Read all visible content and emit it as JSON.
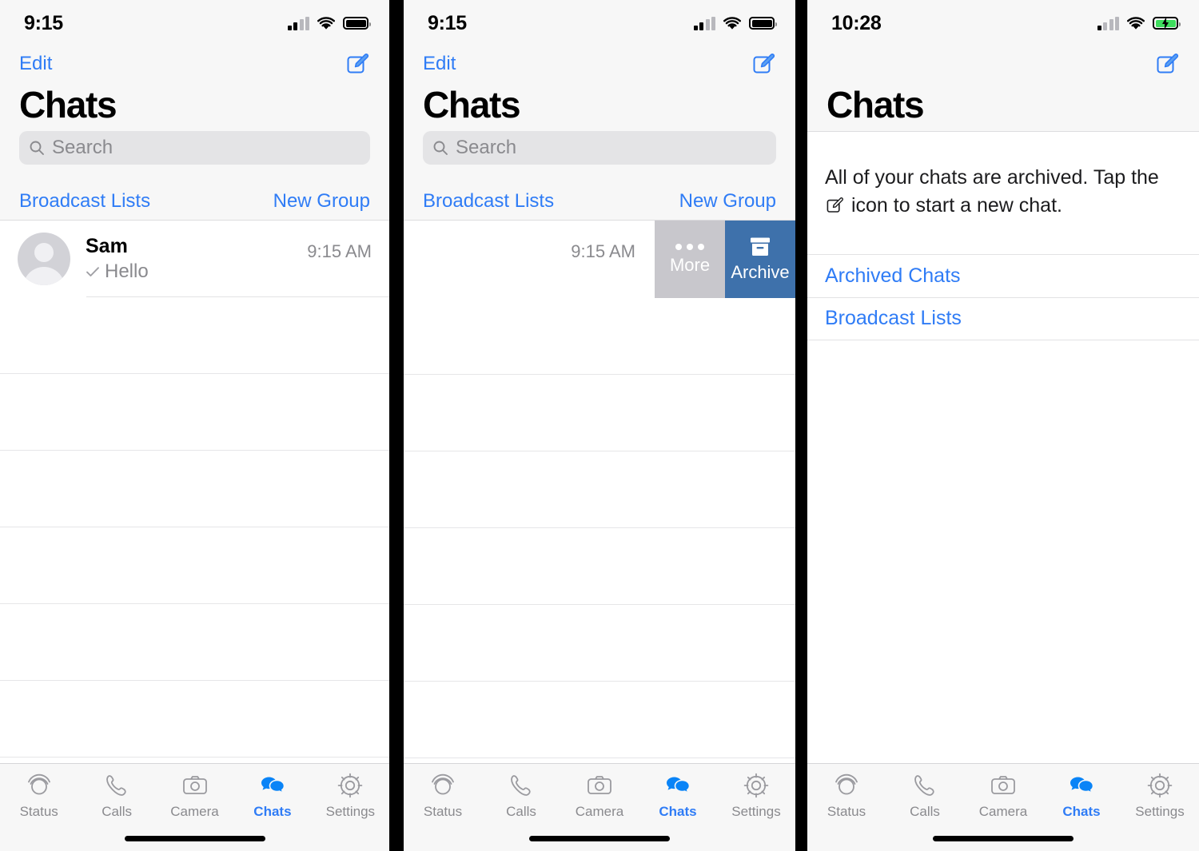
{
  "theme": {
    "accent": "#2f7cf6",
    "archive_bg": "#3e71ab",
    "more_bg": "#c8c7cc",
    "bar_bg": "#f7f7f7",
    "separator": "#e2e2e4",
    "secondary_text": "#8a8a8e",
    "battery_charging": "#3edd5d"
  },
  "panels": [
    {
      "id": "panel-1",
      "status": {
        "time": "9:15",
        "signal_bars": 2,
        "signal_total": 4,
        "wifi": "wifi-icon",
        "battery": "battery-full-icon",
        "charging": false
      },
      "nav": {
        "edit_label": "Edit",
        "compose_icon": "compose-icon",
        "title": "Chats",
        "search_placeholder": "Search",
        "search_value": "",
        "search_icon": "search-icon",
        "show_edit": true,
        "show_search": true
      },
      "section": {
        "left_label": "Broadcast Lists",
        "right_label": "New Group"
      },
      "chat": {
        "avatar": "default-avatar-icon",
        "name": "Sam",
        "status_icon": "sent-check-icon",
        "preview": "Hello",
        "time": "9:15 AM"
      },
      "empty_rows": 6,
      "tabs": [
        {
          "label": "Status",
          "icon": "status-rings-icon",
          "active": false
        },
        {
          "label": "Calls",
          "icon": "phone-icon",
          "active": false
        },
        {
          "label": "Camera",
          "icon": "camera-icon",
          "active": false
        },
        {
          "label": "Chats",
          "icon": "chat-bubbles-icon",
          "active": true
        },
        {
          "label": "Settings",
          "icon": "gear-icon",
          "active": false
        }
      ]
    },
    {
      "id": "panel-2",
      "status": {
        "time": "9:15",
        "signal_bars": 2,
        "signal_total": 4,
        "wifi": "wifi-icon",
        "battery": "battery-full-icon",
        "charging": false
      },
      "nav": {
        "edit_label": "Edit",
        "compose_icon": "compose-icon",
        "title": "Chats",
        "search_placeholder": "Search",
        "search_value": "",
        "search_icon": "search-icon",
        "show_edit": true,
        "show_search": true
      },
      "section": {
        "left_label": "Broadcast Lists",
        "right_label": "New Group"
      },
      "swipe_row": {
        "time": "9:15 AM",
        "actions": [
          {
            "label": "More",
            "icon": "ellipsis-icon",
            "bg": "#c8c7cc"
          },
          {
            "label": "Archive",
            "icon": "archive-box-icon",
            "bg": "#3e71ab"
          }
        ]
      },
      "empty_rows": 6,
      "tabs": [
        {
          "label": "Status",
          "icon": "status-rings-icon",
          "active": false
        },
        {
          "label": "Calls",
          "icon": "phone-icon",
          "active": false
        },
        {
          "label": "Camera",
          "icon": "camera-icon",
          "active": false
        },
        {
          "label": "Chats",
          "icon": "chat-bubbles-icon",
          "active": true
        },
        {
          "label": "Settings",
          "icon": "gear-icon",
          "active": false
        }
      ]
    },
    {
      "id": "panel-3",
      "status": {
        "time": "10:28",
        "signal_bars": 1,
        "signal_total": 4,
        "wifi": "wifi-icon",
        "battery": "battery-charging-icon",
        "charging": true
      },
      "nav": {
        "edit_label": "",
        "compose_icon": "compose-icon",
        "title": "Chats",
        "search_placeholder": "",
        "search_value": "",
        "search_icon": "search-icon",
        "show_edit": false,
        "show_search": false
      },
      "empty_state": {
        "message_before": "All of your chats are archived. Tap the",
        "inline_icon": "compose-icon",
        "message_after": "icon to start a new chat.",
        "links": [
          {
            "label": "Archived Chats"
          },
          {
            "label": "Broadcast Lists"
          }
        ]
      },
      "tabs": [
        {
          "label": "Status",
          "icon": "status-rings-icon",
          "active": false
        },
        {
          "label": "Calls",
          "icon": "phone-icon",
          "active": false
        },
        {
          "label": "Camera",
          "icon": "camera-icon",
          "active": false
        },
        {
          "label": "Chats",
          "icon": "chat-bubbles-icon",
          "active": true
        },
        {
          "label": "Settings",
          "icon": "gear-icon",
          "active": false
        }
      ]
    }
  ]
}
